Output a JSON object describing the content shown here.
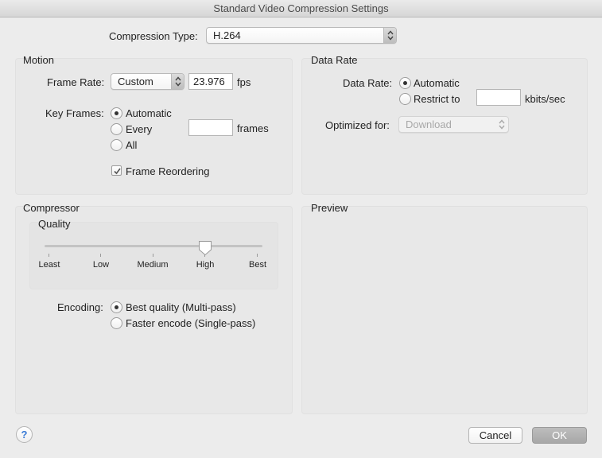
{
  "window": {
    "title": "Standard Video Compression Settings"
  },
  "compression": {
    "label": "Compression Type:",
    "value": "H.264"
  },
  "motion": {
    "title": "Motion",
    "frame_rate_label": "Frame Rate:",
    "frame_rate_mode": "Custom",
    "frame_rate_value": "23.976",
    "fps_unit": "fps",
    "key_frames_label": "Key Frames:",
    "key_frames_options": [
      "Automatic",
      "Every",
      "All"
    ],
    "key_frames_selected": "Automatic",
    "key_frames_every_value": "",
    "frames_unit": "frames",
    "frame_reordering_label": "Frame Reordering",
    "frame_reordering_checked": true
  },
  "data_rate": {
    "title": "Data Rate",
    "label": "Data Rate:",
    "options": [
      "Automatic",
      "Restrict to"
    ],
    "selected": "Automatic",
    "restrict_value": "",
    "unit": "kbits/sec",
    "optimized_label": "Optimized for:",
    "optimized_value": "Download"
  },
  "compressor": {
    "title": "Compressor",
    "quality_label": "Quality",
    "quality_ticks": [
      "Least",
      "Low",
      "Medium",
      "High",
      "Best"
    ],
    "quality_value": "High",
    "encoding_label": "Encoding:",
    "encoding_options": [
      "Best quality (Multi-pass)",
      "Faster encode (Single-pass)"
    ],
    "encoding_selected": "Best quality (Multi-pass)"
  },
  "preview": {
    "title": "Preview"
  },
  "buttons": {
    "help": "?",
    "cancel": "Cancel",
    "ok": "OK"
  }
}
